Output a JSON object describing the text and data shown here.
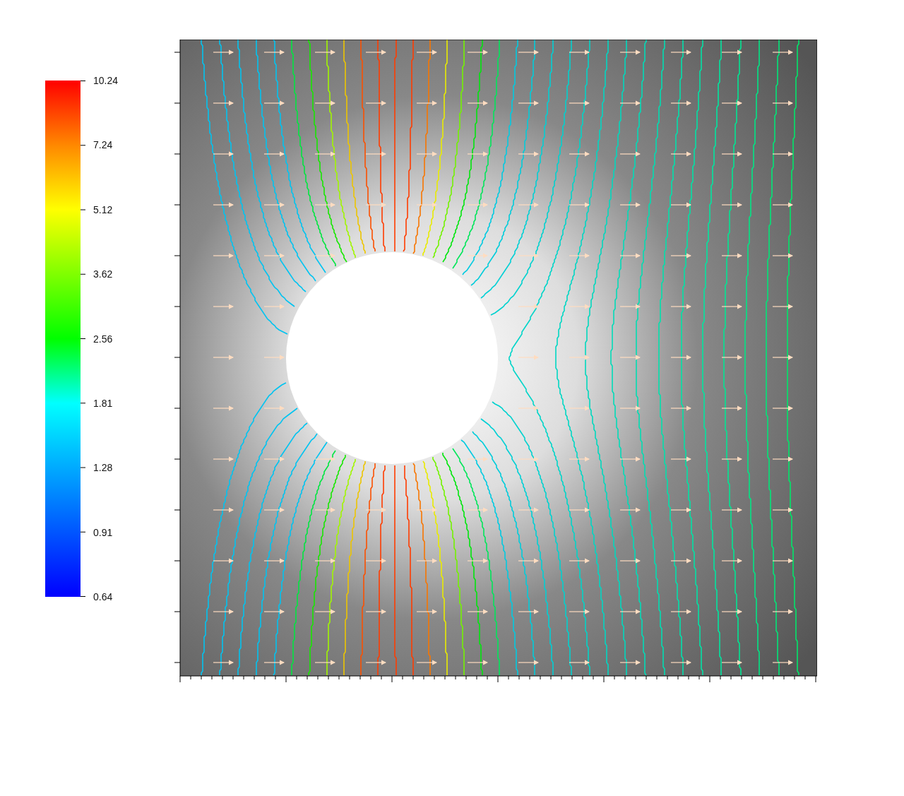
{
  "colorbar": {
    "labels": [
      "10.24",
      "7.24",
      "5.12",
      "3.62",
      "2.56",
      "1.81",
      "1.28",
      "0.91",
      "0.64"
    ]
  }
}
